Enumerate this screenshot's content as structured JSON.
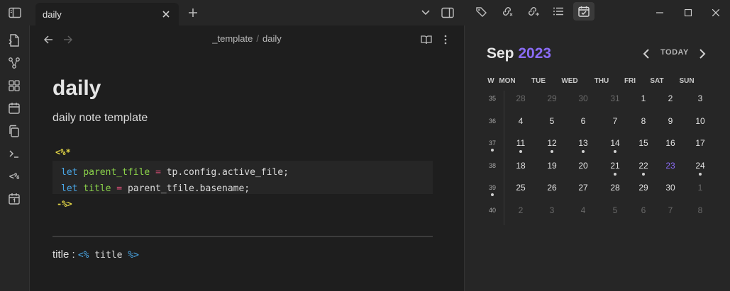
{
  "tab": {
    "title": "daily"
  },
  "breadcrumb": {
    "folder": "_template",
    "separator": "/",
    "file": "daily"
  },
  "ribbon": {
    "icons": [
      "files-icon",
      "graph-icon",
      "canvas-icon",
      "calendar-icon",
      "copy-icon",
      "terminal-icon",
      "templater-icon",
      "daily-note-icon"
    ],
    "templater_label": "<%"
  },
  "note": {
    "heading": "daily",
    "description": "daily note template",
    "code_open": "<%*",
    "code_lines": [
      {
        "kw": "let",
        "name": "parent_tfile",
        "op": "=",
        "expr": "tp.config.active_file;"
      },
      {
        "kw": "let",
        "name": "title",
        "op": "=",
        "expr": "parent_tfile.basename;"
      }
    ],
    "code_close": "-%>",
    "title_label": "title :",
    "tmpl_open": "<%",
    "tmpl_var": "title",
    "tmpl_close": "%>"
  },
  "calendar": {
    "month": "Sep",
    "year": "2023",
    "today_label": "TODAY",
    "headers": [
      "W",
      "MON",
      "TUE",
      "WED",
      "THU",
      "FRI",
      "SAT",
      "SUN"
    ],
    "weeks": [
      {
        "wk": "35",
        "days": [
          "28",
          "29",
          "30",
          "31",
          "1",
          "2",
          "3"
        ],
        "dim": [
          true,
          true,
          true,
          true,
          false,
          false,
          false
        ],
        "dots": [
          false,
          false,
          false,
          false,
          false,
          false,
          false
        ],
        "wkdot": false
      },
      {
        "wk": "36",
        "days": [
          "4",
          "5",
          "6",
          "7",
          "8",
          "9",
          "10"
        ],
        "dim": [
          false,
          false,
          false,
          false,
          false,
          false,
          false
        ],
        "dots": [
          false,
          false,
          false,
          false,
          false,
          false,
          false
        ],
        "wkdot": false
      },
      {
        "wk": "37",
        "days": [
          "11",
          "12",
          "13",
          "14",
          "15",
          "16",
          "17"
        ],
        "dim": [
          false,
          false,
          false,
          false,
          false,
          false,
          false
        ],
        "dots": [
          true,
          true,
          true,
          true,
          false,
          false,
          false
        ],
        "wkdot": true
      },
      {
        "wk": "38",
        "days": [
          "18",
          "19",
          "20",
          "21",
          "22",
          "23",
          "24"
        ],
        "dim": [
          false,
          false,
          false,
          false,
          false,
          false,
          false
        ],
        "dots": [
          false,
          false,
          false,
          true,
          true,
          false,
          true
        ],
        "wkdot": false
      },
      {
        "wk": "39",
        "days": [
          "25",
          "26",
          "27",
          "28",
          "29",
          "30",
          "1"
        ],
        "dim": [
          false,
          false,
          false,
          false,
          false,
          false,
          true
        ],
        "dots": [
          false,
          false,
          false,
          false,
          false,
          false,
          false
        ],
        "wkdot": true
      },
      {
        "wk": "40",
        "days": [
          "2",
          "3",
          "4",
          "5",
          "6",
          "7",
          "8"
        ],
        "dim": [
          true,
          true,
          true,
          true,
          true,
          true,
          true
        ],
        "dots": [
          false,
          false,
          false,
          false,
          false,
          false,
          false
        ],
        "wkdot": false
      }
    ],
    "today": "23"
  },
  "colors": {
    "accent": "#8b6cf6",
    "keyword": "#4aa8e8",
    "variable": "#8bd24a",
    "operator": "#e0507a",
    "templater": "#e5d847"
  }
}
